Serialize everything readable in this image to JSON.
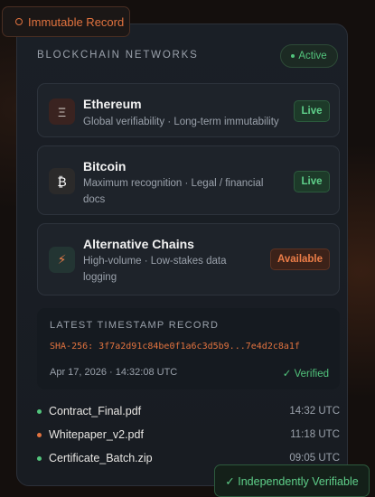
{
  "top_tag": {
    "label": "Immutable Record",
    "accent": "#e2733f"
  },
  "panel": {
    "title": "BLOCKCHAIN NETWORKS",
    "status_badge": "Active"
  },
  "networks": [
    {
      "icon": "ethereum-icon",
      "glyph": "Ξ",
      "name": "Ethereum",
      "desc_lines": [
        "Global verifiability · Long-term immutability"
      ],
      "status": "Live"
    },
    {
      "icon": "bitcoin-icon",
      "glyph": "₿",
      "name": "Bitcoin",
      "desc_lines": [
        "Maximum recognition · Legal / financial",
        "docs"
      ],
      "status": "Live"
    },
    {
      "icon": "lightning-icon",
      "glyph": "⚡",
      "name": "Alternative Chains",
      "desc_lines": [
        "High-volume · Low-stakes data",
        "logging"
      ],
      "status": "Available"
    }
  ],
  "record": {
    "label": "LATEST TIMESTAMP RECORD",
    "hash": "SHA-256: 3f7a2d91c84be0f1a6c3d5b9...7e4d2c8a1f",
    "timestamp": "Apr 17, 2026 · 14:32:08 UTC",
    "verified": "✓ Verified"
  },
  "files": [
    {
      "name": "Contract_Final.pdf",
      "time": "14:32 UTC",
      "status_color": "#52c47c"
    },
    {
      "name": "Whitepaper_v2.pdf",
      "time": "11:18 UTC",
      "status_color": "#e2733f"
    },
    {
      "name": "Certificate_Batch.zip",
      "time": "09:05 UTC",
      "status_color": "#52c47c"
    }
  ],
  "bottom_tag": {
    "label": "✓ Independently Verifiable"
  }
}
